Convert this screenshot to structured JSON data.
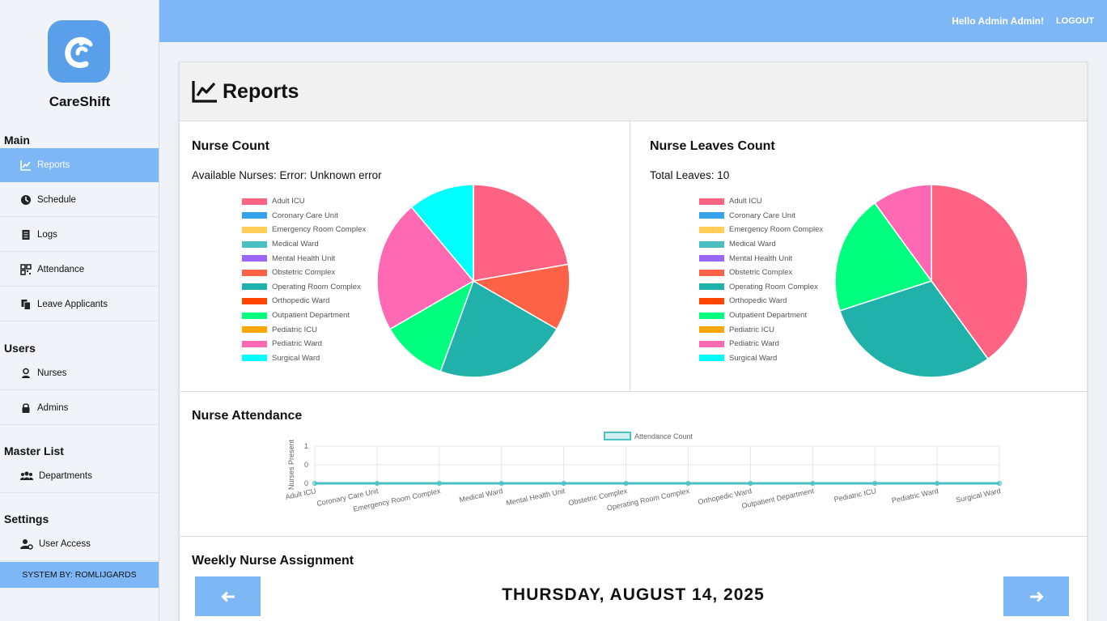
{
  "sidebar": {
    "brand": "CareShift",
    "sections": {
      "main": "Main",
      "users": "Users",
      "master": "Master List",
      "settings": "Settings"
    },
    "items": {
      "reports": "Reports",
      "schedule": "Schedule",
      "logs": "Logs",
      "attendance": "Attendance",
      "leave": "Leave Applicants",
      "nurses": "Nurses",
      "admins": "Admins",
      "departments": "Departments",
      "user_access": "User Access"
    },
    "system_by": "SYSTEM BY: ROMLIJGARDS"
  },
  "topbar": {
    "greeting": "Hello Admin Admin!",
    "logout": "LOGOUT"
  },
  "page": {
    "title": "Reports"
  },
  "nurse_count": {
    "title": "Nurse Count",
    "subtitle": "Available Nurses: Error: Unknown error"
  },
  "leaves": {
    "title": "Nurse Leaves Count",
    "subtitle": "Total Leaves: 10"
  },
  "attendance": {
    "title": "Nurse Attendance"
  },
  "weekly": {
    "title": "Weekly Nurse Assignment",
    "date": "THURSDAY, AUGUST 14, 2025"
  },
  "colors": {
    "accent": "#7db7f6",
    "line": "#4bc0c0"
  },
  "chart_data": [
    {
      "type": "pie",
      "title": "",
      "categories": [
        "Adult ICU",
        "Coronary Care Unit",
        "Emergency Room Complex",
        "Medical Ward",
        "Mental Health Unit",
        "Obstetric Complex",
        "Operating Room Complex",
        "Orthopedic Ward",
        "Outpatient Department",
        "Pediatric ICU",
        "Pediatric Ward",
        "Surgical Ward"
      ],
      "colors": [
        "#ff6384",
        "#36a2eb",
        "#ffce56",
        "#4bc0c0",
        "#9966ff",
        "#ff6347",
        "#20b2aa",
        "#ff4500",
        "#00ff7f",
        "#ffa500",
        "#ff69b4",
        "#00ffff"
      ],
      "values": [
        2,
        0,
        0,
        0,
        0,
        1,
        2,
        0,
        1,
        0,
        2,
        1
      ]
    },
    {
      "type": "pie",
      "title": "",
      "categories": [
        "Adult ICU",
        "Coronary Care Unit",
        "Emergency Room Complex",
        "Medical Ward",
        "Mental Health Unit",
        "Obstetric Complex",
        "Operating Room Complex",
        "Orthopedic Ward",
        "Outpatient Department",
        "Pediatric ICU",
        "Pediatric Ward",
        "Surgical Ward"
      ],
      "colors": [
        "#ff6384",
        "#36a2eb",
        "#ffce56",
        "#4bc0c0",
        "#9966ff",
        "#ff6347",
        "#20b2aa",
        "#ff4500",
        "#00ff7f",
        "#ffa500",
        "#ff69b4",
        "#00ffff"
      ],
      "values": [
        4,
        0,
        0,
        0,
        0,
        0,
        3,
        0,
        2,
        0,
        1,
        0
      ]
    },
    {
      "type": "line",
      "title": "",
      "categories": [
        "Adult ICU",
        "Coronary Care Unit",
        "Emergency Room Complex",
        "Medical Ward",
        "Mental Health Unit",
        "Obstetric Complex",
        "Operating Room Complex",
        "Orthopedic Ward",
        "Outpatient Department",
        "Pediatric ICU",
        "Pediatric Ward",
        "Surgical Ward"
      ],
      "series": [
        {
          "name": "Attendance Count",
          "values": [
            0,
            0,
            0,
            0,
            0,
            0,
            0,
            0,
            0,
            0,
            0,
            0
          ]
        }
      ],
      "ylabel": "Nurses Present",
      "xlabel": "",
      "yticks": [
        "1",
        "0",
        "0"
      ],
      "ylim": [
        0,
        1
      ],
      "legend": "top"
    }
  ]
}
